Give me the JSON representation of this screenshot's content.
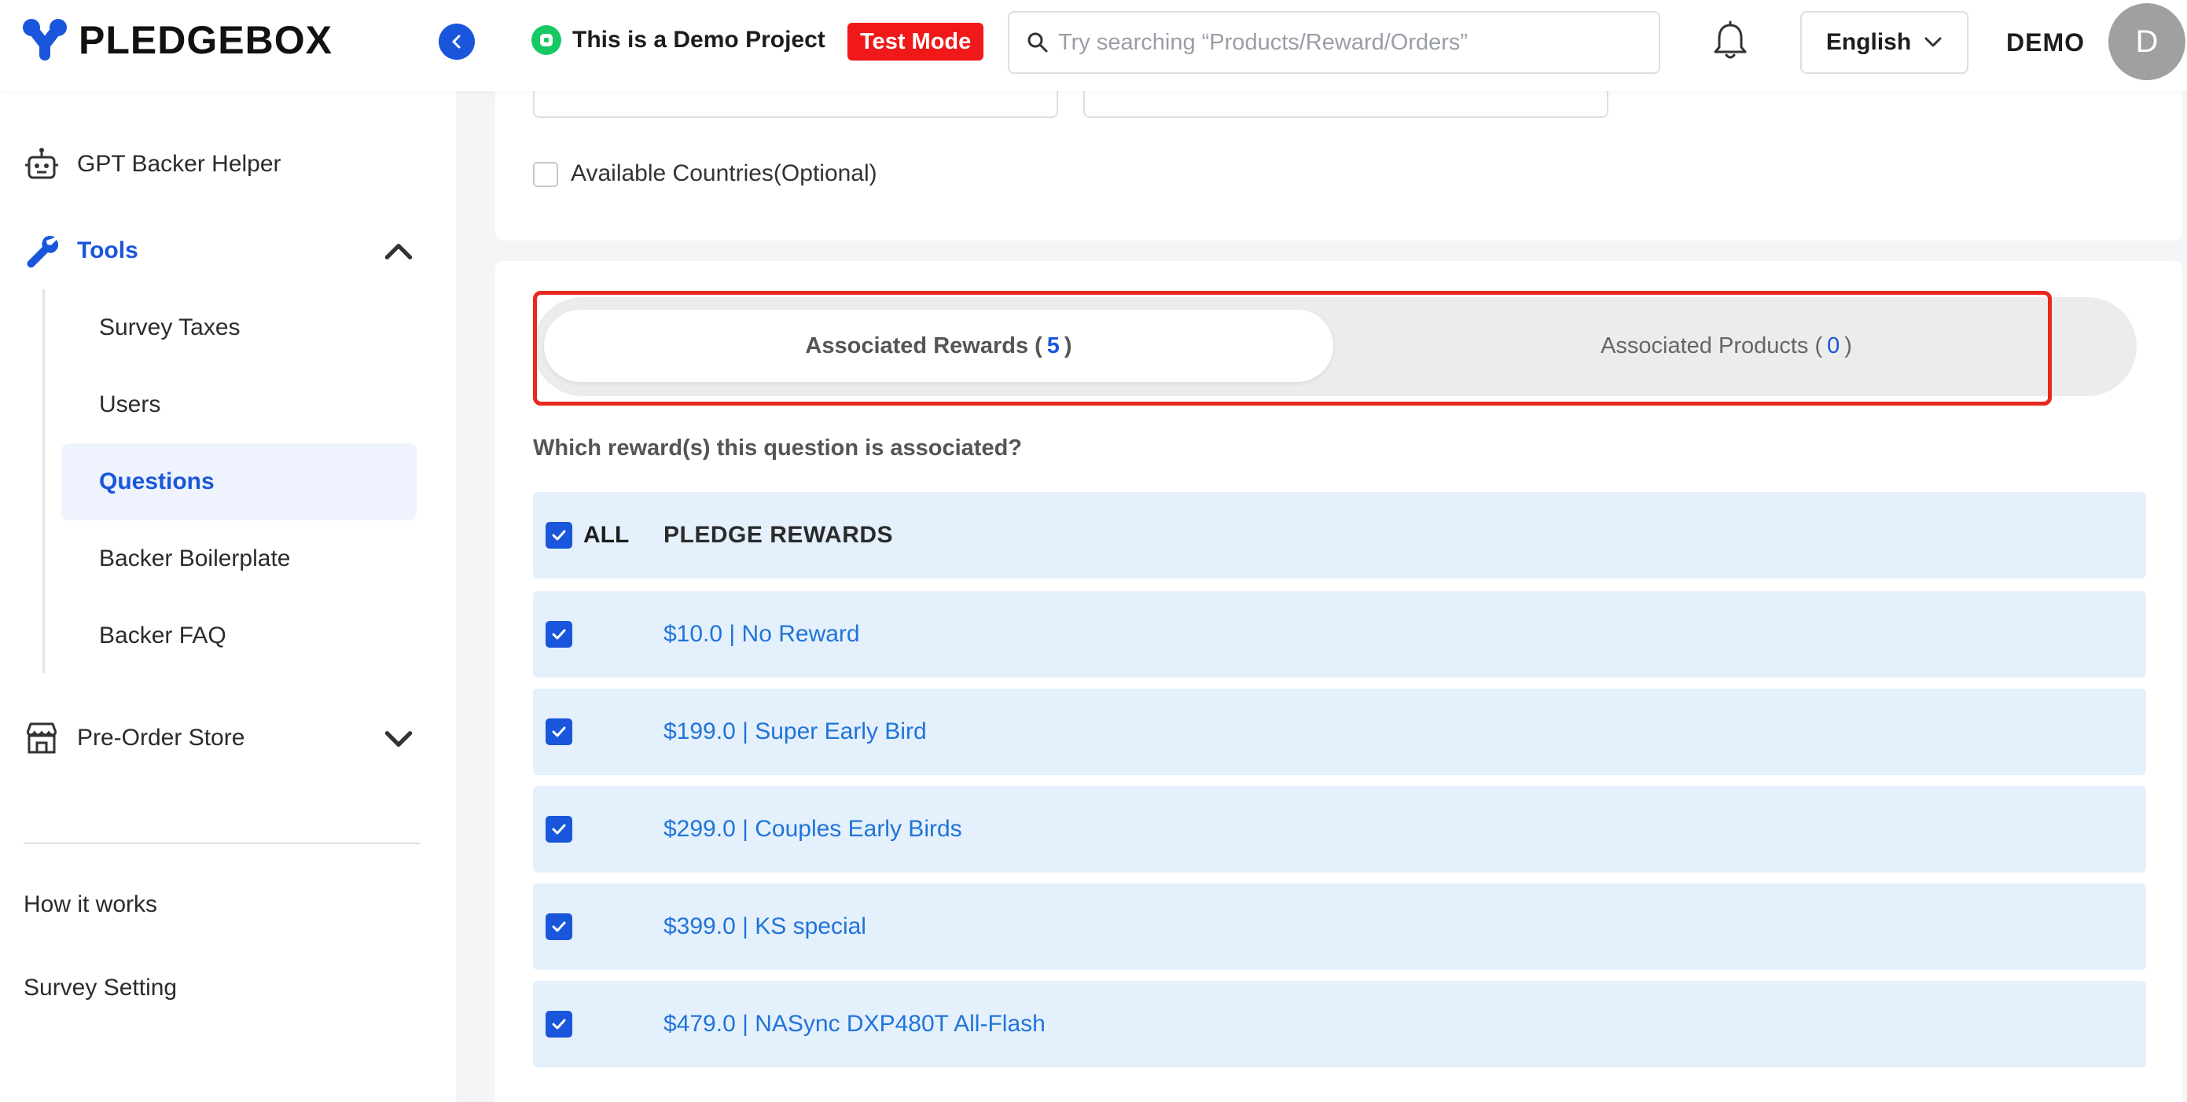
{
  "brand": {
    "name": "PLEDGEBOX",
    "accent": "#1a56db"
  },
  "header": {
    "project_name": "This is a Demo Project",
    "test_mode_label": "Test Mode",
    "search_placeholder": "Try searching “Products/Reward/Orders”",
    "language": "English",
    "user_name": "DEMO",
    "avatar_initial": "D"
  },
  "sidebar": {
    "gpt_helper": "GPT Backer Helper",
    "tools": {
      "label": "Tools",
      "items": [
        "Survey Taxes",
        "Users",
        "Questions",
        "Backer Boilerplate",
        "Backer FAQ"
      ],
      "active": "Questions"
    },
    "preorder_store": "Pre-Order Store",
    "how_it_works": "How it works",
    "survey_setting": "Survey Setting"
  },
  "main": {
    "available_countries_label": "Available Countries(Optional)",
    "tabs": [
      {
        "label": "Associated Rewards",
        "count": "5",
        "active": true
      },
      {
        "label": "Associated Products",
        "count": "0",
        "active": false
      }
    ],
    "question_text": "Which reward(s) this question is associated?",
    "table": {
      "all_label": "ALL",
      "header": "PLEDGE REWARDS",
      "rewards": [
        "$10.0 | No Reward",
        "$199.0 | Super Early Bird",
        "$299.0 | Couples Early Birds",
        "$399.0 | KS special",
        "$479.0 | NASync DXP480T All-Flash"
      ]
    }
  },
  "colors": {
    "highlight": "#e8281e",
    "test_mode_bg": "#f01818",
    "row_bg": "#e5f0fd",
    "reward_link": "#1f74d8"
  }
}
